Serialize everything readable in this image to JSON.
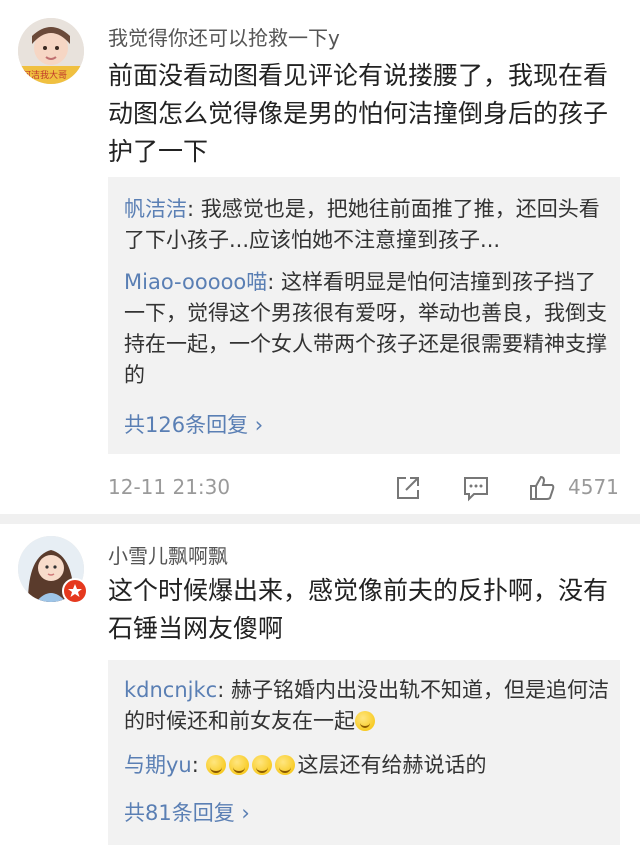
{
  "comments": [
    {
      "username": "我觉得你还可以抢救一下y",
      "text": "前面没看动图看见评论有说搂腰了，我现在看动图怎么觉得像是男的怕何洁撞倒身后的孩子护了一下",
      "avatar_text": "何洁我大哥",
      "replies": [
        {
          "author": "帆洁洁",
          "text": "我感觉也是，把她往前面推了推，还回头看了下小孩子...应该怕她不注意撞到孩子..."
        },
        {
          "author": "Miao-ooooo喵",
          "text": "这样看明显是怕何洁撞到孩子挡了一下，觉得这个男孩很有爱呀，举动也善良，我倒支持在一起，一个女人带两个孩子还是很需要精神支撑的"
        }
      ],
      "more_replies": "共126条回复 ›",
      "timestamp": "12-11 21:30",
      "likes": "4571"
    },
    {
      "username": "小雪儿飘啊飘",
      "text": "这个时候爆出来，感觉像前夫的反扑啊，没有石锤当网友傻啊",
      "replies": [
        {
          "author": "kdncnjkc",
          "text": "赫子铭婚内出没出轨不知道，但是追何洁的时候还和前女友在一起"
        },
        {
          "author": "与期yu",
          "text": "这层还有给赫说话的"
        }
      ],
      "more_replies": "共81条回复 ›"
    }
  ],
  "icons": {
    "share": "share-icon",
    "comment": "comment-icon",
    "like": "thumbs-up-icon",
    "emoji_smile": "slight-smile-emoji",
    "emoji_sweat": "sweat-smile-emoji",
    "badge": "verified-badge-icon"
  },
  "colors": {
    "link": "#5a7fb4",
    "reply_bg": "#f2f2f2",
    "muted": "#9a9a9a",
    "badge": "#e5391e"
  }
}
